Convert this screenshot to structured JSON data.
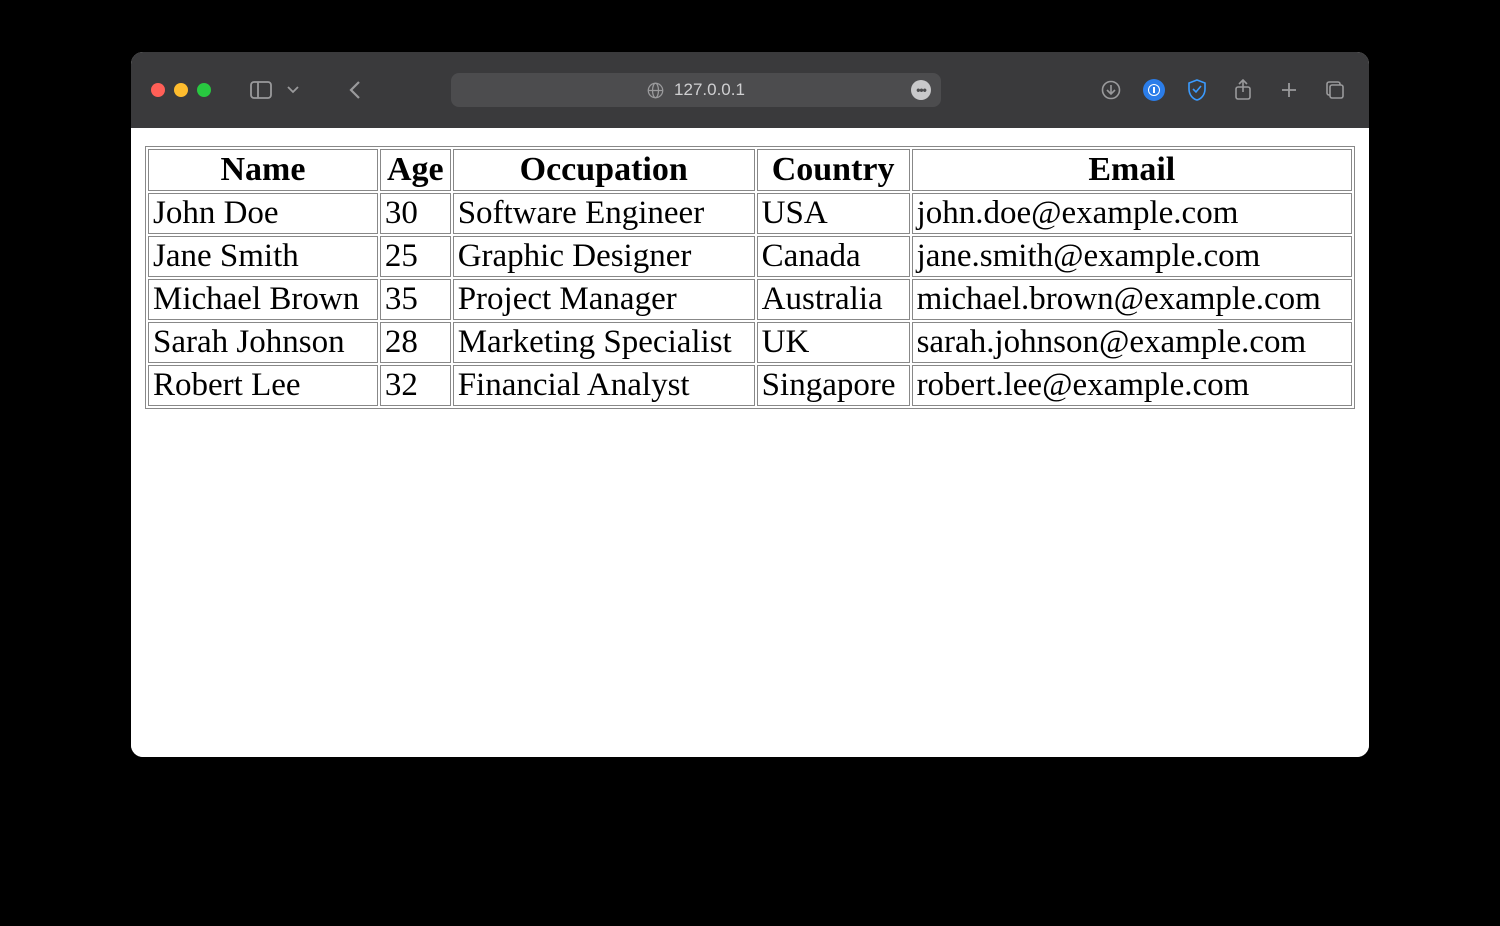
{
  "browser": {
    "address": "127.0.0.1"
  },
  "table": {
    "headers": [
      "Name",
      "Age",
      "Occupation",
      "Country",
      "Email"
    ],
    "rows": [
      {
        "name": "John Doe",
        "age": "30",
        "occupation": "Software Engineer",
        "country": "USA",
        "email": "john.doe@example.com"
      },
      {
        "name": "Jane Smith",
        "age": "25",
        "occupation": "Graphic Designer",
        "country": "Canada",
        "email": "jane.smith@example.com"
      },
      {
        "name": "Michael Brown",
        "age": "35",
        "occupation": "Project Manager",
        "country": "Australia",
        "email": "michael.brown@example.com"
      },
      {
        "name": "Sarah Johnson",
        "age": "28",
        "occupation": "Marketing Specialist",
        "country": "UK",
        "email": "sarah.johnson@example.com"
      },
      {
        "name": "Robert Lee",
        "age": "32",
        "occupation": "Financial Analyst",
        "country": "Singapore",
        "email": "robert.lee@example.com"
      }
    ]
  }
}
